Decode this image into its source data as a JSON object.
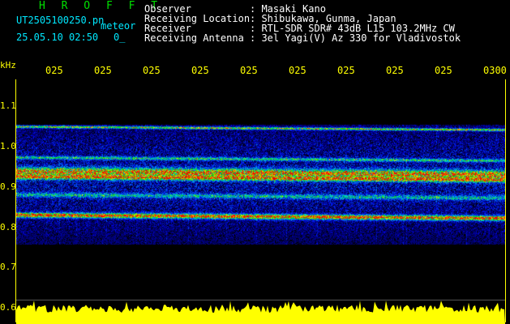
{
  "header": {
    "brand": "H R O F F T",
    "filename": "UT2505100250.pn",
    "kind": "meteor",
    "datetime": "25.05.10 02:50",
    "extra": "0_"
  },
  "info": [
    {
      "key": "Observer",
      "value": ": Masaki Kano"
    },
    {
      "key": "Receiving Location",
      "value": ": Shibukawa, Gunma, Japan"
    },
    {
      "key": "Receiver",
      "value": ": RTL-SDR SDR# 43dB L15 103.2MHz CW"
    },
    {
      "key": "Receiving Antenna",
      "value": ": 3el Yagi(V) Az 330 for Vladivostok"
    }
  ],
  "axis": {
    "unit": "kHz",
    "time_ticks": [
      "025",
      "025",
      "025",
      "025",
      "025",
      "025",
      "025",
      "025",
      "025",
      "0300"
    ],
    "freq_ticks": [
      "1.1",
      "1.0",
      "0.9",
      "0.8",
      "0.7",
      "0.6"
    ]
  },
  "colors": {
    "background": "#000000",
    "axis": "#ffff00",
    "brand": "#00e000",
    "filename": "#00e8ff",
    "info": "#ffffff",
    "amplitude": "#ffff00"
  }
}
